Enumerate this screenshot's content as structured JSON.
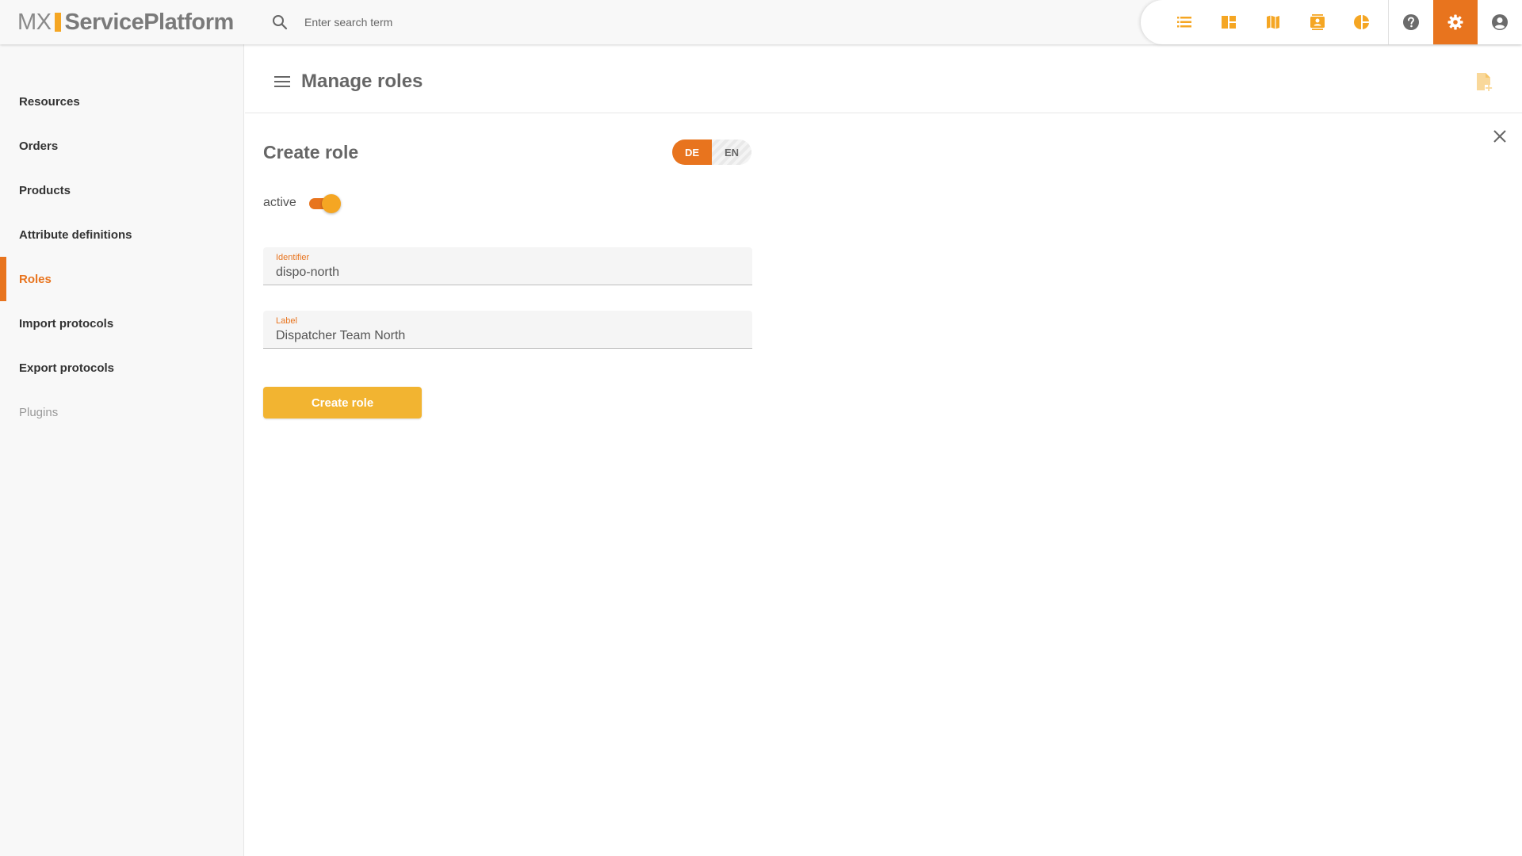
{
  "app": {
    "logo_left": "MX",
    "logo_right": "ServicePlatform"
  },
  "search": {
    "placeholder": "Enter search term",
    "value": ""
  },
  "toolbar": {
    "icons": [
      "list-icon",
      "dashboard-icon",
      "map-icon",
      "contacts-icon",
      "pie-chart-icon",
      "help-icon",
      "settings-icon",
      "account-icon"
    ],
    "active": "settings-icon"
  },
  "sidebar": {
    "items": [
      {
        "label": "Resources",
        "state": "normal"
      },
      {
        "label": "Orders",
        "state": "normal"
      },
      {
        "label": "Products",
        "state": "normal"
      },
      {
        "label": "Attribute definitions",
        "state": "normal"
      },
      {
        "label": "Roles",
        "state": "active"
      },
      {
        "label": "Import protocols",
        "state": "normal"
      },
      {
        "label": "Export protocols",
        "state": "normal"
      },
      {
        "label": "Plugins",
        "state": "disabled"
      }
    ]
  },
  "header": {
    "title": "Manage roles"
  },
  "form": {
    "title": "Create role",
    "languages": [
      {
        "code": "DE",
        "selected": true
      },
      {
        "code": "EN",
        "selected": false
      }
    ],
    "active_label": "active",
    "active_on": true,
    "identifier": {
      "label": "Identifier",
      "value": "dispo-north"
    },
    "label_field": {
      "label": "Label",
      "value": "Dispatcher Team North"
    },
    "submit_label": "Create role"
  },
  "colors": {
    "accent": "#e8741e",
    "primary_button": "#f2b431",
    "icon_yellow": "#f5a623"
  }
}
